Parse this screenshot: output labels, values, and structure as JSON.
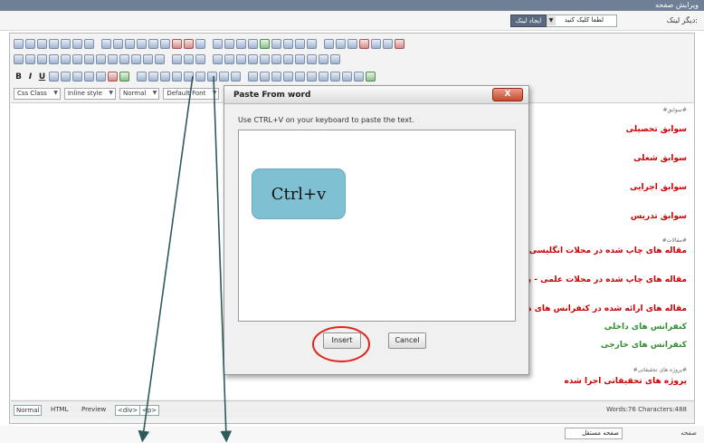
{
  "header": {
    "title": "ویرایش صفحه"
  },
  "link_row": {
    "label": "دیگر لینک:",
    "select_value": "لطفا کلیک کنید",
    "create_button": "ایجاد لینک"
  },
  "toolbar": {
    "bold": "B",
    "italic": "I",
    "underline": "U",
    "dropdowns": [
      "Css Class",
      "Inline style",
      "Normal",
      "Default Font"
    ]
  },
  "content": {
    "items": [
      {
        "style": "small",
        "text": "#سوابق#"
      },
      {
        "style": "red",
        "text": "سوابق تحصیلی"
      },
      {
        "style": "red",
        "text": "سوابق شغلی"
      },
      {
        "style": "red",
        "text": "سوابق اجرایی"
      },
      {
        "style": "red",
        "text": "سوابق تدریس"
      },
      {
        "style": "small",
        "text": "#مقالات#"
      },
      {
        "style": "red",
        "text": "مقاله های چاپ شده در مجلات انگلیسی"
      },
      {
        "style": "red",
        "text": "مقاله های چاپ شده در مجلات علمی - پژوهشی"
      },
      {
        "style": "red",
        "text": "مقاله های ارائه شده در کنفرانس های داخلی و"
      },
      {
        "style": "green",
        "text": "کنفرانس های داخلی"
      },
      {
        "style": "green",
        "text": "کنفرانس های خارجی"
      },
      {
        "style": "small",
        "text": "#پروژه های تحقیقاتی#"
      },
      {
        "style": "red",
        "text": "پروژه های تحقیقاتی اجرا شده"
      }
    ]
  },
  "status_bar": {
    "modes": [
      "Normal",
      "HTML",
      "Preview"
    ],
    "tags": [
      "<div>",
      "<p>"
    ],
    "word_count": "Words:76 Characters:488"
  },
  "bottom_row": {
    "select_value": "صفحه مستقل",
    "label": "صفحه"
  },
  "dialog": {
    "title": "Paste From word",
    "close_label": "X",
    "hint": "Use CTRL+V on your keyboard to paste the text.",
    "textarea_value": "",
    "insert_label": "Insert",
    "cancel_label": "Cancel"
  },
  "callout": {
    "text": "Ctrl+v"
  },
  "annotations": {
    "arrow_color": "#2e5a5a",
    "circle_color": "#e0231c"
  }
}
